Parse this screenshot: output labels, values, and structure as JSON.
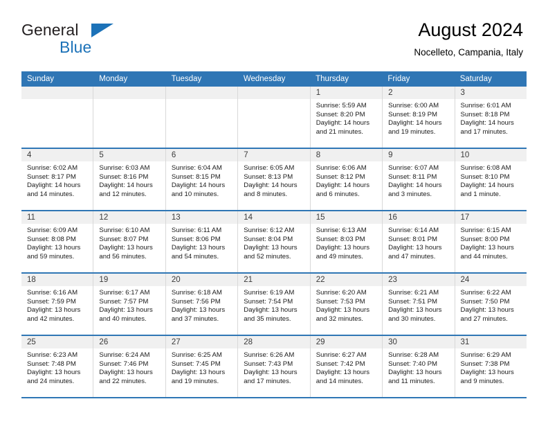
{
  "brand": {
    "name_top": "General",
    "name_bottom": "Blue",
    "color_dark": "#231f20",
    "color_blue": "#1c72b8",
    "triangle_icon": "triangle-icon"
  },
  "header": {
    "title": "August 2024",
    "subtitle": "Nocelleto, Campania, Italy"
  },
  "theme": {
    "header_row_bg": "#2f76b5",
    "date_bar_bg": "#f0f0f0",
    "cell_bg": "#ffffff",
    "row_divider": "#2f76b5",
    "column_divider": "#d8d8d8"
  },
  "calendar": {
    "weekday_headers": [
      "Sunday",
      "Monday",
      "Tuesday",
      "Wednesday",
      "Thursday",
      "Friday",
      "Saturday"
    ],
    "weeks": [
      [
        {
          "day": "",
          "empty": true
        },
        {
          "day": "",
          "empty": true
        },
        {
          "day": "",
          "empty": true
        },
        {
          "day": "",
          "empty": true
        },
        {
          "day": "1",
          "sunrise": "Sunrise: 5:59 AM",
          "sunset": "Sunset: 8:20 PM",
          "daylight": "Daylight: 14 hours and 21 minutes."
        },
        {
          "day": "2",
          "sunrise": "Sunrise: 6:00 AM",
          "sunset": "Sunset: 8:19 PM",
          "daylight": "Daylight: 14 hours and 19 minutes."
        },
        {
          "day": "3",
          "sunrise": "Sunrise: 6:01 AM",
          "sunset": "Sunset: 8:18 PM",
          "daylight": "Daylight: 14 hours and 17 minutes."
        }
      ],
      [
        {
          "day": "4",
          "sunrise": "Sunrise: 6:02 AM",
          "sunset": "Sunset: 8:17 PM",
          "daylight": "Daylight: 14 hours and 14 minutes."
        },
        {
          "day": "5",
          "sunrise": "Sunrise: 6:03 AM",
          "sunset": "Sunset: 8:16 PM",
          "daylight": "Daylight: 14 hours and 12 minutes."
        },
        {
          "day": "6",
          "sunrise": "Sunrise: 6:04 AM",
          "sunset": "Sunset: 8:15 PM",
          "daylight": "Daylight: 14 hours and 10 minutes."
        },
        {
          "day": "7",
          "sunrise": "Sunrise: 6:05 AM",
          "sunset": "Sunset: 8:13 PM",
          "daylight": "Daylight: 14 hours and 8 minutes."
        },
        {
          "day": "8",
          "sunrise": "Sunrise: 6:06 AM",
          "sunset": "Sunset: 8:12 PM",
          "daylight": "Daylight: 14 hours and 6 minutes."
        },
        {
          "day": "9",
          "sunrise": "Sunrise: 6:07 AM",
          "sunset": "Sunset: 8:11 PM",
          "daylight": "Daylight: 14 hours and 3 minutes."
        },
        {
          "day": "10",
          "sunrise": "Sunrise: 6:08 AM",
          "sunset": "Sunset: 8:10 PM",
          "daylight": "Daylight: 14 hours and 1 minute."
        }
      ],
      [
        {
          "day": "11",
          "sunrise": "Sunrise: 6:09 AM",
          "sunset": "Sunset: 8:08 PM",
          "daylight": "Daylight: 13 hours and 59 minutes."
        },
        {
          "day": "12",
          "sunrise": "Sunrise: 6:10 AM",
          "sunset": "Sunset: 8:07 PM",
          "daylight": "Daylight: 13 hours and 56 minutes."
        },
        {
          "day": "13",
          "sunrise": "Sunrise: 6:11 AM",
          "sunset": "Sunset: 8:06 PM",
          "daylight": "Daylight: 13 hours and 54 minutes."
        },
        {
          "day": "14",
          "sunrise": "Sunrise: 6:12 AM",
          "sunset": "Sunset: 8:04 PM",
          "daylight": "Daylight: 13 hours and 52 minutes."
        },
        {
          "day": "15",
          "sunrise": "Sunrise: 6:13 AM",
          "sunset": "Sunset: 8:03 PM",
          "daylight": "Daylight: 13 hours and 49 minutes."
        },
        {
          "day": "16",
          "sunrise": "Sunrise: 6:14 AM",
          "sunset": "Sunset: 8:01 PM",
          "daylight": "Daylight: 13 hours and 47 minutes."
        },
        {
          "day": "17",
          "sunrise": "Sunrise: 6:15 AM",
          "sunset": "Sunset: 8:00 PM",
          "daylight": "Daylight: 13 hours and 44 minutes."
        }
      ],
      [
        {
          "day": "18",
          "sunrise": "Sunrise: 6:16 AM",
          "sunset": "Sunset: 7:59 PM",
          "daylight": "Daylight: 13 hours and 42 minutes."
        },
        {
          "day": "19",
          "sunrise": "Sunrise: 6:17 AM",
          "sunset": "Sunset: 7:57 PM",
          "daylight": "Daylight: 13 hours and 40 minutes."
        },
        {
          "day": "20",
          "sunrise": "Sunrise: 6:18 AM",
          "sunset": "Sunset: 7:56 PM",
          "daylight": "Daylight: 13 hours and 37 minutes."
        },
        {
          "day": "21",
          "sunrise": "Sunrise: 6:19 AM",
          "sunset": "Sunset: 7:54 PM",
          "daylight": "Daylight: 13 hours and 35 minutes."
        },
        {
          "day": "22",
          "sunrise": "Sunrise: 6:20 AM",
          "sunset": "Sunset: 7:53 PM",
          "daylight": "Daylight: 13 hours and 32 minutes."
        },
        {
          "day": "23",
          "sunrise": "Sunrise: 6:21 AM",
          "sunset": "Sunset: 7:51 PM",
          "daylight": "Daylight: 13 hours and 30 minutes."
        },
        {
          "day": "24",
          "sunrise": "Sunrise: 6:22 AM",
          "sunset": "Sunset: 7:50 PM",
          "daylight": "Daylight: 13 hours and 27 minutes."
        }
      ],
      [
        {
          "day": "25",
          "sunrise": "Sunrise: 6:23 AM",
          "sunset": "Sunset: 7:48 PM",
          "daylight": "Daylight: 13 hours and 24 minutes."
        },
        {
          "day": "26",
          "sunrise": "Sunrise: 6:24 AM",
          "sunset": "Sunset: 7:46 PM",
          "daylight": "Daylight: 13 hours and 22 minutes."
        },
        {
          "day": "27",
          "sunrise": "Sunrise: 6:25 AM",
          "sunset": "Sunset: 7:45 PM",
          "daylight": "Daylight: 13 hours and 19 minutes."
        },
        {
          "day": "28",
          "sunrise": "Sunrise: 6:26 AM",
          "sunset": "Sunset: 7:43 PM",
          "daylight": "Daylight: 13 hours and 17 minutes."
        },
        {
          "day": "29",
          "sunrise": "Sunrise: 6:27 AM",
          "sunset": "Sunset: 7:42 PM",
          "daylight": "Daylight: 13 hours and 14 minutes."
        },
        {
          "day": "30",
          "sunrise": "Sunrise: 6:28 AM",
          "sunset": "Sunset: 7:40 PM",
          "daylight": "Daylight: 13 hours and 11 minutes."
        },
        {
          "day": "31",
          "sunrise": "Sunrise: 6:29 AM",
          "sunset": "Sunset: 7:38 PM",
          "daylight": "Daylight: 13 hours and 9 minutes."
        }
      ]
    ]
  }
}
